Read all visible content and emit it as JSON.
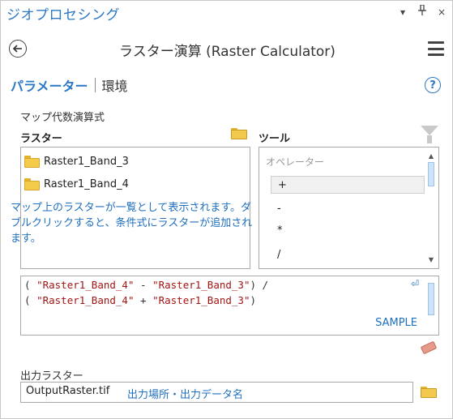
{
  "pane": {
    "title": "ジオプロセシング",
    "controls": [
      "▾",
      "ᗅ",
      "×"
    ]
  },
  "tool": {
    "title": "ラスター演算 (Raster Calculator)",
    "back_icon": "back-arrow-icon",
    "menu_icon": "hamburger-menu-icon"
  },
  "tabs": {
    "parameters": "パラメーター",
    "environments": "環境"
  },
  "help_glyph": "?",
  "map_algebra": {
    "label": "マップ代数演算式",
    "rasters_label": "ラスター",
    "tools_label": "ツール",
    "rasters": [
      {
        "label": "Raster1_Band_3"
      },
      {
        "label": "Raster1_Band_4"
      }
    ],
    "raster_note": "マップ上のラスターが一覧として表示されます。ダブルクリックすると、条件式にラスターが追加されます。",
    "operators_header": "オペレーター",
    "operators": [
      "+",
      "-",
      "*",
      "/"
    ],
    "selected_operator_index": 0
  },
  "expression": {
    "line1_open": "( ",
    "line1_a": "\"Raster1_Band_4\"",
    "line1_op": " - ",
    "line1_b": "\"Raster1_Band_3\"",
    "line1_close": ") /",
    "line2_open": "( ",
    "line2_a": "\"Raster1_Band_4\"",
    "line2_op": " + ",
    "line2_b": "\"Raster1_Band_3\"",
    "line2_close": ")",
    "sample_label": "SAMPLE"
  },
  "output": {
    "label": "出力ラスター",
    "value": "OutputRaster.tif",
    "hint": "出力場所・出力データ名"
  },
  "colors": {
    "accent": "#2b78c5",
    "annotation": "#1f6fbf",
    "string_literal": "#a31515",
    "folder": "#f5cb4c"
  }
}
